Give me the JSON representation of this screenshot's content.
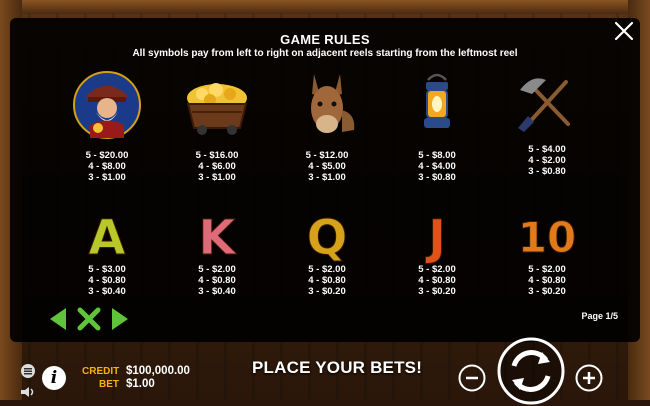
{
  "rules": {
    "title": "GAME RULES",
    "subtitle": "All symbols pay from left to right on adjacent reels starting from the leftmost reel",
    "page": "Page 1/5"
  },
  "symbols": [
    {
      "name": "miner-icon",
      "pays": [
        "5 - $20.00",
        "4 - $8.00",
        "3 - $1.00"
      ]
    },
    {
      "name": "gold-cart-icon",
      "pays": [
        "5 - $16.00",
        "4 - $6.00",
        "3 - $1.00"
      ]
    },
    {
      "name": "donkey-icon",
      "pays": [
        "5 - $12.00",
        "4 - $5.00",
        "3 - $1.00"
      ]
    },
    {
      "name": "lantern-icon",
      "pays": [
        "5 - $8.00",
        "4 - $4.00",
        "3 - $0.80"
      ]
    },
    {
      "name": "shovel-pickaxe-icon",
      "pays": [
        "5 - $4.00",
        "4 - $2.00",
        "3 - $0.80"
      ]
    },
    {
      "name": "letter-a",
      "letter": "A",
      "pays": [
        "5 - $3.00",
        "4 - $0.80",
        "3 - $0.40"
      ]
    },
    {
      "name": "letter-k",
      "letter": "K",
      "pays": [
        "5 - $2.00",
        "4 - $0.80",
        "3 - $0.40"
      ]
    },
    {
      "name": "letter-q",
      "letter": "Q",
      "pays": [
        "5 - $2.00",
        "4 - $0.80",
        "3 - $0.20"
      ]
    },
    {
      "name": "letter-j",
      "letter": "J",
      "pays": [
        "5 - $2.00",
        "4 - $0.80",
        "3 - $0.20"
      ]
    },
    {
      "name": "number-10",
      "letter": "10",
      "pays": [
        "5 - $2.00",
        "4 - $0.80",
        "3 - $0.20"
      ]
    }
  ],
  "colors": {
    "A": "#b8c82a",
    "K": "#e06a7a",
    "Q": "#d6a21c",
    "J": "#e0521a",
    "10": "#e07a1a",
    "nav_green": "#5fc43a",
    "label_gold": "#f5b400"
  },
  "footer": {
    "credit_label": "CREDIT",
    "credit_value": "$100,000.00",
    "bet_label": "BET",
    "bet_value": "$1.00",
    "place_bets": "PLACE YOUR BETS!",
    "info_glyph": "i"
  }
}
